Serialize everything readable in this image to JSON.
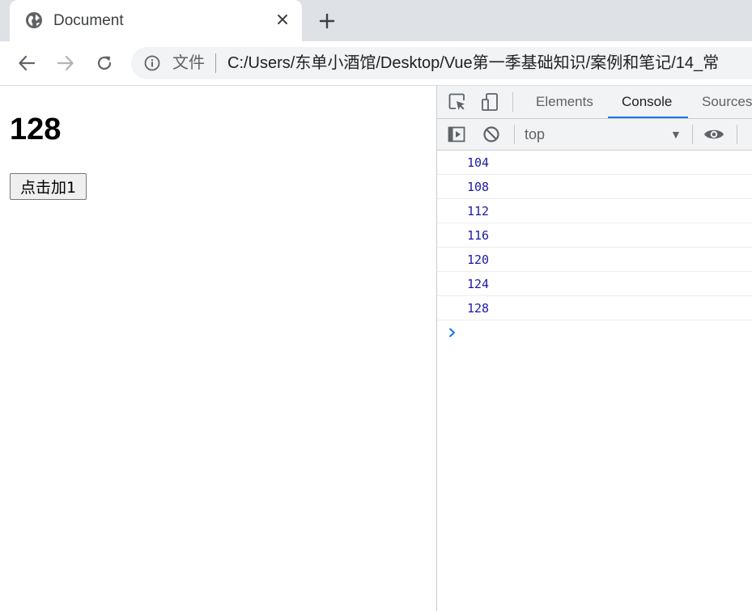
{
  "browser": {
    "tab": {
      "title": "Document",
      "favicon": "globe-icon"
    },
    "toolbar": {
      "file_label": "文件",
      "url": "C:/Users/东单小酒馆/Desktop/Vue第一季基础知识/案例和笔记/14_常"
    }
  },
  "page": {
    "counter": "128",
    "button_label": "点击加1"
  },
  "devtools": {
    "tabs": [
      {
        "label": "Elements",
        "active": false
      },
      {
        "label": "Console",
        "active": true
      },
      {
        "label": "Sources",
        "active": false
      }
    ],
    "context": "top",
    "console_logs": [
      "104",
      "108",
      "112",
      "116",
      "120",
      "124",
      "128"
    ]
  },
  "colors": {
    "accent": "#1a73e8",
    "console_number": "#1a1aa6",
    "tabstrip_bg": "#dee1e6"
  }
}
